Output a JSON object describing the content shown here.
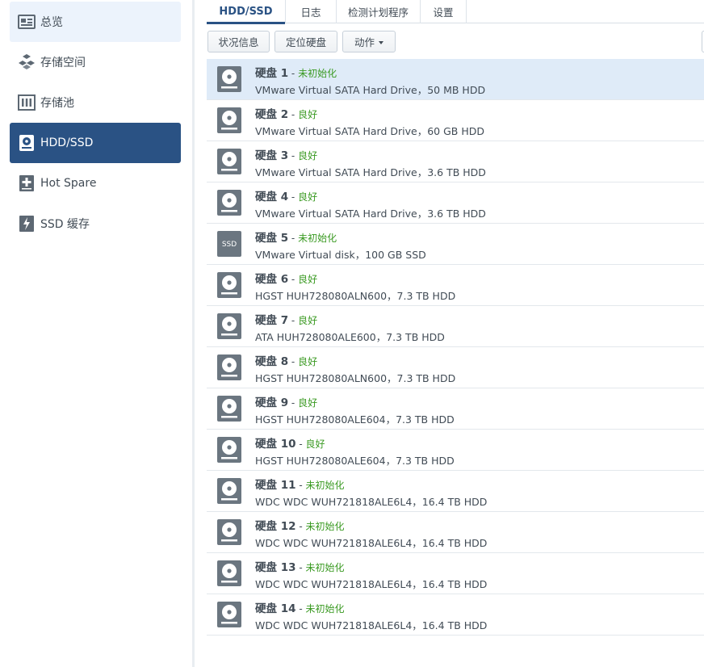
{
  "sidebar": {
    "items": [
      {
        "label": "总览",
        "icon": "overview-icon"
      },
      {
        "label": "存储空间",
        "icon": "storage-space-icon"
      },
      {
        "label": "存储池",
        "icon": "storage-pool-icon"
      },
      {
        "label": "HDD/SSD",
        "icon": "hdd-ssd-icon"
      },
      {
        "label": "Hot Spare",
        "icon": "hot-spare-icon"
      },
      {
        "label": "SSD 缓存",
        "icon": "ssd-cache-icon"
      }
    ]
  },
  "tabs": [
    {
      "label": "HDD/SSD"
    },
    {
      "label": "日志"
    },
    {
      "label": "检测计划程序"
    },
    {
      "label": "设置"
    }
  ],
  "toolbar": {
    "status_label": "状况信息",
    "locate_label": "定位硬盘",
    "action_label": "动作"
  },
  "colors": {
    "accent": "#2a5284",
    "status_green": "#3a9a22",
    "selected_row": "#dfebf8",
    "icon_gray": "#6b7680"
  },
  "disks": [
    {
      "name": "硬盘 1",
      "sep": " - ",
      "status": "未初始化",
      "model": "VMware Virtual SATA Hard Drive，50 MB HDD",
      "type": "hdd"
    },
    {
      "name": "硬盘 2",
      "sep": " - ",
      "status": "良好",
      "model": "VMware Virtual SATA Hard Drive，60 GB HDD",
      "type": "hdd"
    },
    {
      "name": "硬盘 3",
      "sep": " - ",
      "status": "良好",
      "model": "VMware Virtual SATA Hard Drive，3.6 TB HDD",
      "type": "hdd"
    },
    {
      "name": "硬盘 4",
      "sep": " - ",
      "status": "良好",
      "model": "VMware Virtual SATA Hard Drive，3.6 TB HDD",
      "type": "hdd"
    },
    {
      "name": "硬盘 5",
      "sep": " - ",
      "status": "未初始化",
      "model": "VMware Virtual disk，100 GB SSD",
      "type": "ssd",
      "icon_text": "SSD"
    },
    {
      "name": "硬盘 6",
      "sep": " - ",
      "status": "良好",
      "model": "HGST HUH728080ALN600，7.3 TB HDD",
      "type": "hdd"
    },
    {
      "name": "硬盘 7",
      "sep": " - ",
      "status": "良好",
      "model": "ATA HUH728080ALE600，7.3 TB HDD",
      "type": "hdd"
    },
    {
      "name": "硬盘 8",
      "sep": " - ",
      "status": "良好",
      "model": "HGST HUH728080ALN600，7.3 TB HDD",
      "type": "hdd"
    },
    {
      "name": "硬盘 9",
      "sep": " - ",
      "status": "良好",
      "model": "HGST HUH728080ALE604，7.3 TB HDD",
      "type": "hdd"
    },
    {
      "name": "硬盘 10",
      "sep": " - ",
      "status": "良好",
      "model": "HGST HUH728080ALE604，7.3 TB HDD",
      "type": "hdd"
    },
    {
      "name": "硬盘 11",
      "sep": " - ",
      "status": "未初始化",
      "model": "WDC WDC WUH721818ALE6L4，16.4 TB HDD",
      "type": "hdd"
    },
    {
      "name": "硬盘 12",
      "sep": " - ",
      "status": "未初始化",
      "model": "WDC WDC WUH721818ALE6L4，16.4 TB HDD",
      "type": "hdd"
    },
    {
      "name": "硬盘 13",
      "sep": " - ",
      "status": "未初始化",
      "model": "WDC WDC WUH721818ALE6L4，16.4 TB HDD",
      "type": "hdd"
    },
    {
      "name": "硬盘 14",
      "sep": " - ",
      "status": "未初始化",
      "model": "WDC WDC WUH721818ALE6L4，16.4 TB HDD",
      "type": "hdd"
    }
  ]
}
